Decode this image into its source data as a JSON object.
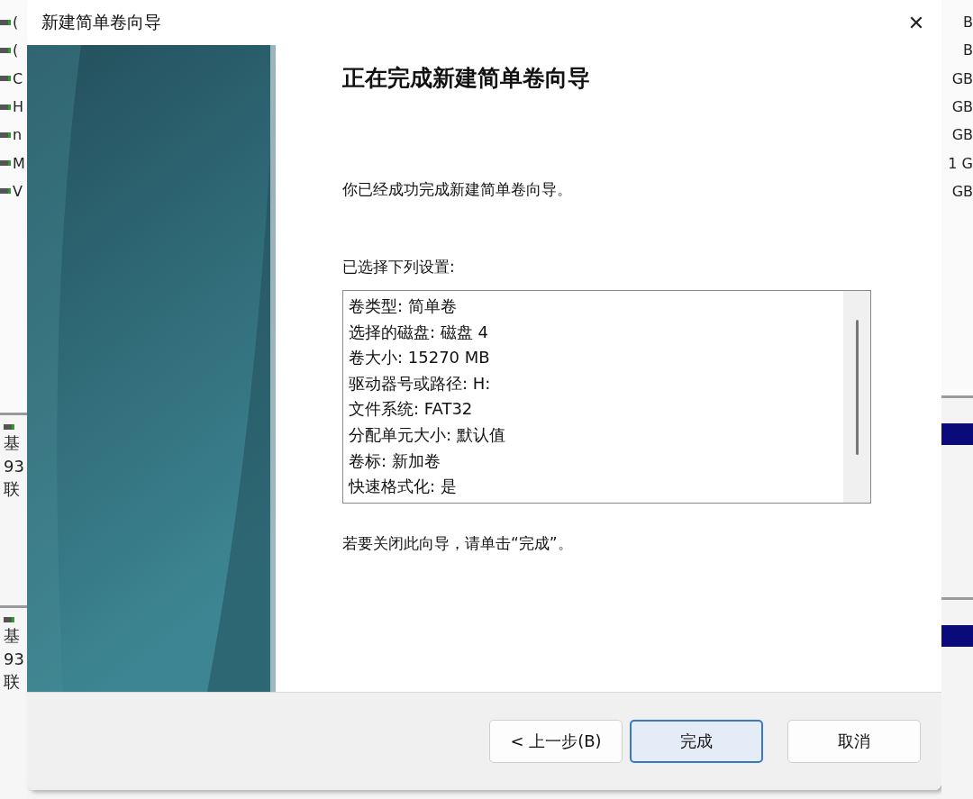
{
  "background_window": {
    "left_rows": [
      "(",
      "(",
      "C",
      "H",
      "n",
      "M",
      "V"
    ],
    "right_rows": [
      "B",
      "B",
      "GB",
      "GB",
      "GB",
      "1 G",
      "GB"
    ],
    "disk_panels": [
      {
        "lines": [
          "基",
          "93",
          "联"
        ]
      },
      {
        "lines": [
          "基",
          "93",
          "联"
        ]
      }
    ]
  },
  "window": {
    "title": "新建简单卷向导",
    "close": "✕"
  },
  "heading": "正在完成新建简单卷向导",
  "intro": "你已经成功完成新建简单卷向导。",
  "settings_label": "已选择下列设置:",
  "settings": [
    "卷类型: 简单卷",
    "选择的磁盘: 磁盘 4",
    "卷大小: 15270 MB",
    "驱动器号或路径: H:",
    "文件系统: FAT32",
    "分配单元大小: 默认值",
    "卷标: 新加卷",
    "快速格式化: 是"
  ],
  "note": "若要关闭此向导，请单击“完成”。",
  "buttons": [
    {
      "label": "< 上一步(B)",
      "default": false
    },
    {
      "label": "完成",
      "default": true
    },
    {
      "label": "取消",
      "default": false
    }
  ]
}
